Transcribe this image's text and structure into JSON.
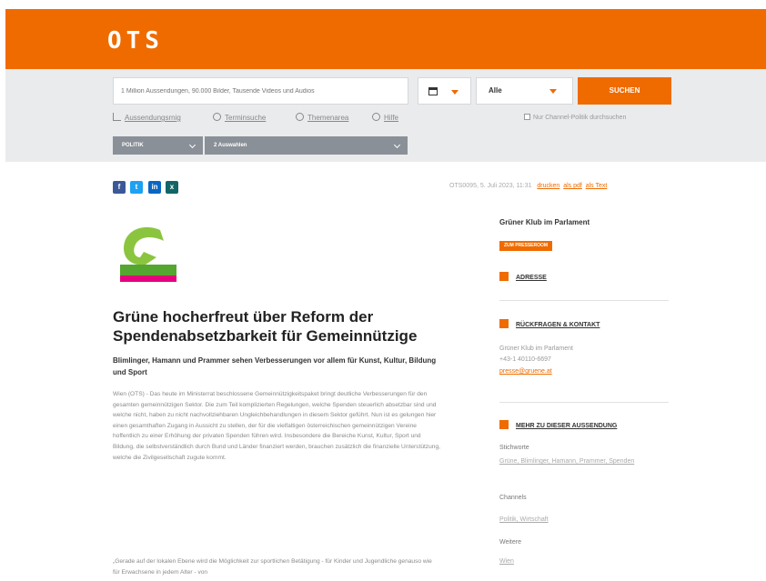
{
  "brand": {
    "logo": "OTS",
    "color": "#ef6b00"
  },
  "search": {
    "placeholder": "1 Million Aussendungen, 90.000 Bilder, Tausende Videos und Audios",
    "date_icon": "calendar-icon",
    "select_value": "Alle",
    "button_label": "SUCHEN"
  },
  "sublinks": [
    {
      "label": "Aussendungsrnig",
      "icon": "bar-chart-icon"
    },
    {
      "label": "Terminsuche",
      "icon": "clock-icon"
    },
    {
      "label": "Themenarea",
      "icon": "globe-icon"
    },
    {
      "label": "Hilfe",
      "icon": "info-icon"
    }
  ],
  "checkbox_label": "Nur Channel-Politik durchsuchen",
  "filters": [
    {
      "label": "POLITIK"
    },
    {
      "label": "2 Auswahlen"
    }
  ],
  "share": {
    "icons": [
      "facebook-icon",
      "twitter-icon",
      "linkedin-icon",
      "xing-icon"
    ]
  },
  "meta": {
    "text": "OTS0095, 5. Juli 2023, 11:31",
    "links": [
      "drucken",
      "als pdf",
      "als Text"
    ]
  },
  "article": {
    "title": "Grüne hocherfreut über Reform der Spendenabsetzbarkeit für Gemeinnützige",
    "lead": "Blimlinger, Hamann und Prammer sehen Verbesserungen vor allem für Kunst, Kultur, Bildung und Sport",
    "body": "Wien (OTS) - Das heute im Ministerrat beschlossene Gemeinnützigkeitspaket bringt deutliche Verbesserungen für den gesamten gemeinnützigen Sektor. Die zum Teil komplizierten Regelungen, welche Spenden steuerlich absetzbar sind und welche nicht, haben zu nicht nachvollziehbaren Ungleichbehandlungen in diesem Sektor geführt. Nun ist es gelungen hier einen gesamthaften Zugang in Aussicht zu stellen, der für die vielfaltigen österreichischen gemeinnützigen Vereine hoffentlich zu einer Erhöhung der privaten Spenden führen wird. Insbesondere die Bereiche Kunst, Kultur, Sport und Bildung, die selbstverständlich durch Bund und Länder finanziert werden, brauchen zusätzlich die finanzielle Unterstützung, welche die Zivilgesellschaft zugute kommt.",
    "body2": "„Gerade auf der lokalen Ebene wird die Möglichkeit zur sportlichen Betätigung - für Kinder und Jugendliche genauso wie für Erwachsene in jedem Alter - von"
  },
  "sidebar": {
    "org_name": "Grüner Klub im Parlament",
    "press_tag": "ZUM PRESSEROOM",
    "address_label": "ADRESSE",
    "contact_label": "RÜCKFRAGEN & KONTAKT",
    "contact_lines": [
      "Grüner Klub im Parlament",
      "+43-1 40110-6697"
    ],
    "contact_email": "presse@gruene.at",
    "more_label": "MEHR ZU DIESER AUSSENDUNG",
    "keywords_label": "Stichworte",
    "keywords": "Grüne, Blimlinger, Hamann, Prammer, Spenden",
    "channels_label": "Channels",
    "channels": "Politik, Wirtschaft",
    "region_label": "Weitere",
    "region": "Wien"
  }
}
